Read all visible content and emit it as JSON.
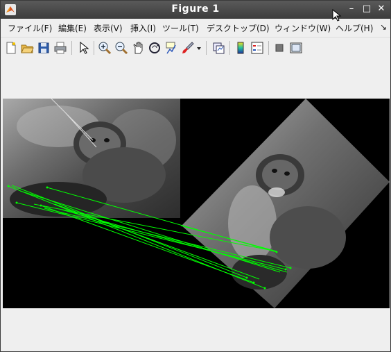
{
  "window": {
    "title": "Figure 1"
  },
  "titlebar": {
    "minimize": "–",
    "maximize": "□",
    "close": "✕"
  },
  "menu": [
    "ファイル(F)",
    "編集(E)",
    "表示(V)",
    "挿入(I)",
    "ツール(T)",
    "デスクトップ(D)",
    "ウィンドウ(W)",
    "ヘルプ(H)",
    "↘"
  ],
  "toolbar_icons": [
    "new-figure-icon",
    "open-file-icon",
    "save-icon",
    "print-icon",
    "pointer-icon",
    "zoom-in-icon",
    "zoom-out-icon",
    "pan-icon",
    "rotate-3d-icon",
    "data-cursor-icon",
    "brush-icon",
    "brush-dropdown-icon",
    "link-plot-icon",
    "colorbar-icon",
    "legend-icon",
    "hide-plot-tools-icon",
    "show-plot-tools-icon"
  ],
  "figure": {
    "background": "#000000",
    "match_line_color": "#00ff00",
    "description_images": [
      "original-ocelot-image",
      "rotated-ocelot-image"
    ]
  }
}
